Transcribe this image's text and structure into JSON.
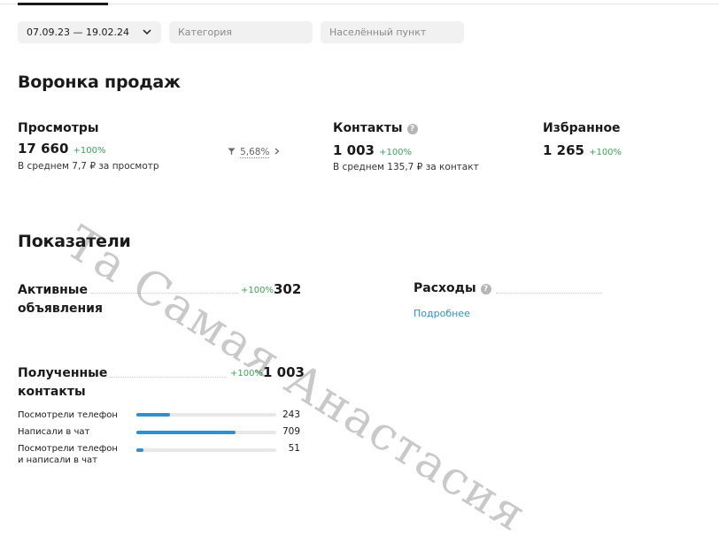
{
  "filters": {
    "date_range": "07.09.23 — 19.02.24",
    "category_placeholder": "Категория",
    "city_placeholder": "Населённый пункт"
  },
  "funnel": {
    "title": "Воронка продаж",
    "views": {
      "label": "Просмотры",
      "value": "17 660",
      "change": "+100%",
      "sub": "В среднем 7,7 ₽ за просмотр",
      "conversion": "5,68%"
    },
    "contacts": {
      "label": "Контакты",
      "help": "?",
      "value": "1 003",
      "change": "+100%",
      "sub": "В среднем 135,7 ₽ за контакт"
    },
    "favorites": {
      "label": "Избранное",
      "value": "1 265",
      "change": "+100%"
    }
  },
  "indicators": {
    "title": "Показатели",
    "active_ads": {
      "label_line1": "Активные",
      "label_line2": "объявления",
      "change": "+100%",
      "value": "302"
    },
    "expenses": {
      "label": "Расходы",
      "help": "?",
      "link": "Подробнее"
    },
    "received_contacts": {
      "label_line1": "Полученные",
      "label_line2": "контакты",
      "change": "+100%",
      "value": "1 003",
      "rows": [
        {
          "label_line1": "Посмотрели телефон",
          "label_line2": "",
          "value": "243",
          "fraction": 0.24
        },
        {
          "label_line1": "Написали в чат",
          "label_line2": "",
          "value": "709",
          "fraction": 0.71
        },
        {
          "label_line1": "Посмотрели телефон",
          "label_line2": "и написали в чат",
          "value": "51",
          "fraction": 0.05
        }
      ]
    }
  },
  "watermark": "Та Самая Анастасия",
  "colors": {
    "accent_green": "#3fa35b",
    "bar_blue": "#2e8fd1",
    "link_blue": "#2f8fc9"
  }
}
